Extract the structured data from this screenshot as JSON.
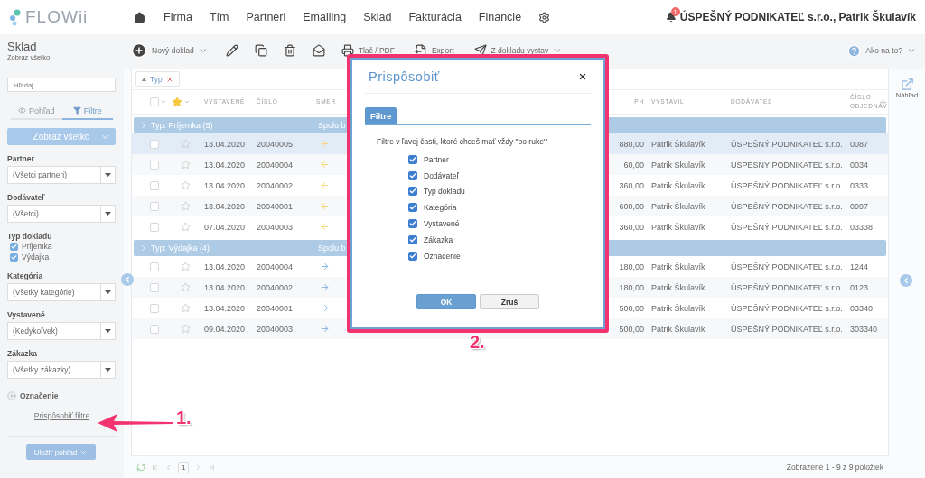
{
  "app": {
    "logo": "FLOWii"
  },
  "nav": {
    "items": [
      {
        "label": "Firma"
      },
      {
        "label": "Tím"
      },
      {
        "label": "Partneri"
      },
      {
        "label": "Emailing"
      },
      {
        "label": "Sklad"
      },
      {
        "label": "Fakturácia"
      },
      {
        "label": "Financie"
      }
    ],
    "notifications": "1",
    "account": "ÚSPEŠNÝ PODNIKATEĽ s.r.o., Patrik Škulavík"
  },
  "toolbar": {
    "title": "Sklad",
    "subtitle": "Zobraz všetko",
    "new_label": "Nový doklad",
    "print_label": "Tlač / PDF",
    "export_label": "Export",
    "issue_label": "Z dokladu vystav",
    "help_label": "Ako na to?"
  },
  "sidebar": {
    "search_placeholder": "Hľadaj...",
    "tabs": [
      {
        "kind": "eye",
        "label": "Pohľad",
        "selected": false
      },
      {
        "kind": "funnel",
        "label": "Filtre",
        "selected": true
      }
    ],
    "view_button": "Zobraz všetko",
    "filters": [
      {
        "kind": "select",
        "label": "Partner",
        "value": "(Všetci partneri)"
      },
      {
        "kind": "select",
        "label": "Dodávateľ",
        "value": "(Všetci)"
      },
      {
        "kind": "checks",
        "label": "Typ dokladu",
        "options": [
          {
            "label": "Príjemka",
            "checked": true
          },
          {
            "label": "Výdajka",
            "checked": true
          }
        ]
      },
      {
        "kind": "select",
        "label": "Kategória",
        "value": "(Všetky kategórie)"
      },
      {
        "kind": "select",
        "label": "Vystavené",
        "value": "(Kedykoľvek)"
      },
      {
        "kind": "select",
        "label": "Zákazka",
        "value": "(Všetky zákazky)"
      },
      {
        "kind": "add",
        "label": "Označenie"
      }
    ],
    "customize_link": "Prispôsobiť filtre",
    "save_button": "Uložiť pohľad"
  },
  "table": {
    "chip": "Typ",
    "all_checked": false,
    "columns": [
      "VYSTAVENÉ",
      "ČÍSLO",
      "SMER",
      "PH",
      "VYSTAVIL",
      "DODÁVATEĽ",
      "ČÍSLO OBJEDNÁV"
    ],
    "groups": [
      {
        "title": "Typ: Príjemka (5)",
        "sum": "Spolu b",
        "rows": [
          {
            "kind": "in",
            "date": "13.04.2020",
            "number": "20040005",
            "amount": "880,00",
            "issuer": "Patrik Škulavík",
            "supplier": "ÚSPEŠNÝ PODNIKATEĽ s.r.o.",
            "order": "0087",
            "checked": false,
            "starred": false,
            "highlighted": true
          },
          {
            "kind": "in",
            "date": "13.04.2020",
            "number": "20040004",
            "amount": "60,00",
            "issuer": "Patrik Škulavík",
            "supplier": "ÚSPEŠNÝ PODNIKATEĽ s.r.o.",
            "order": "0034",
            "checked": false,
            "starred": false,
            "highlighted": false
          },
          {
            "kind": "in",
            "date": "13.04.2020",
            "number": "20040002",
            "amount": "360,00",
            "issuer": "Patrik Škulavík",
            "supplier": "ÚSPEŠNÝ PODNIKATEĽ s.r.o.",
            "order": "0333",
            "checked": false,
            "starred": false,
            "highlighted": false
          },
          {
            "kind": "in",
            "date": "13.04.2020",
            "number": "20040001",
            "amount": "600,00",
            "issuer": "Patrik Škulavík",
            "supplier": "ÚSPEŠNÝ PODNIKATEĽ s.r.o.",
            "order": "0997",
            "checked": false,
            "starred": false,
            "highlighted": false
          },
          {
            "kind": "in",
            "date": "07.04.2020",
            "number": "20040003",
            "amount": "360,00",
            "issuer": "Patrik Škulavík",
            "supplier": "ÚSPEŠNÝ PODNIKATEĽ s.r.o.",
            "order": "03338",
            "checked": false,
            "starred": false,
            "highlighted": false
          }
        ]
      },
      {
        "title": "Typ: Výdajka (4)",
        "sum": "Spolu b",
        "rows": [
          {
            "kind": "out",
            "date": "13.04.2020",
            "number": "20040004",
            "amount": "180,00",
            "issuer": "Patrik Škulavík",
            "supplier": "ÚSPEŠNÝ PODNIKATEĽ s.r.o.",
            "order": "1244",
            "checked": false,
            "starred": false,
            "highlighted": false
          },
          {
            "kind": "out",
            "date": "13.04.2020",
            "number": "20040002",
            "amount": "180,00",
            "issuer": "Patrik Škulavík",
            "supplier": "ÚSPEŠNÝ PODNIKATEĽ s.r.o.",
            "order": "0123",
            "checked": false,
            "starred": false,
            "highlighted": false
          },
          {
            "kind": "out",
            "date": "13.04.2020",
            "number": "20040001",
            "amount": "500,00",
            "issuer": "Patrik Škulavík",
            "supplier": "ÚSPEŠNÝ PODNIKATEĽ s.r.o.",
            "order": "03340",
            "checked": false,
            "starred": false,
            "highlighted": false
          },
          {
            "kind": "out",
            "date": "09.04.2020",
            "number": "20040003",
            "amount": "500,00",
            "issuer": "Patrik Škulavík",
            "supplier": "ÚSPEŠNÝ PODNIKATEĽ s.r.o.",
            "order": "303340",
            "checked": false,
            "starred": false,
            "highlighted": false
          }
        ]
      }
    ],
    "page": "1",
    "status": "Zobrazené 1 - 9 z 9 položiek"
  },
  "preview_label": "Náhľad",
  "dialog": {
    "title": "Prispôsobiť",
    "tab": "Filtre",
    "intro": "Filtre v ľavej časti, ktoré chceš mať vždy \"po ruke\"",
    "options": [
      {
        "label": "Partner",
        "checked": true
      },
      {
        "label": "Dodávateľ",
        "checked": true
      },
      {
        "label": "Typ dokladu",
        "checked": true
      },
      {
        "label": "Kategória",
        "checked": true
      },
      {
        "label": "Vystavené",
        "checked": true
      },
      {
        "label": "Zákazka",
        "checked": true
      },
      {
        "label": "Označenie",
        "checked": true
      }
    ],
    "ok": "OK",
    "cancel": "Zruš"
  },
  "annotations": [
    {
      "label": "1."
    },
    {
      "label": "2."
    }
  ]
}
